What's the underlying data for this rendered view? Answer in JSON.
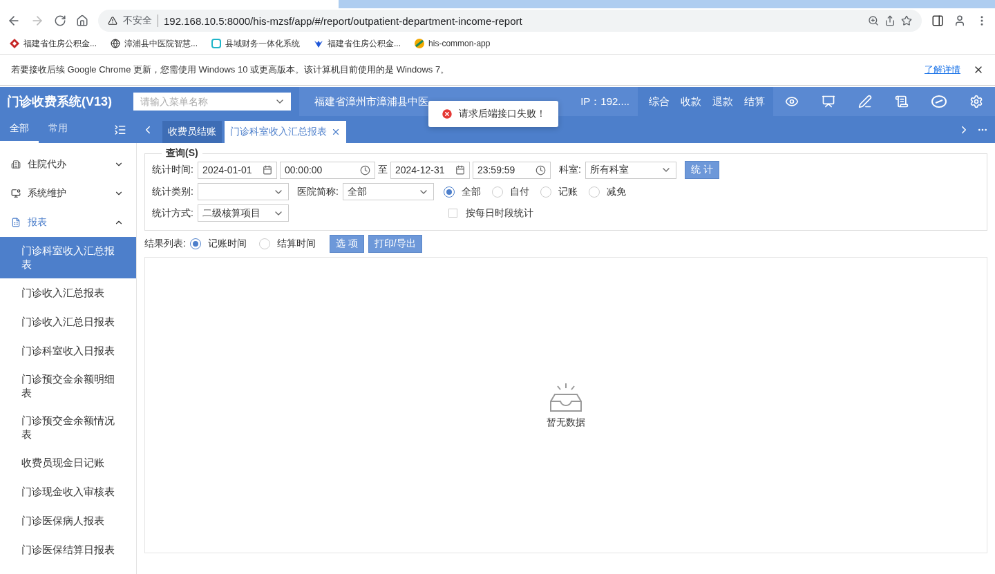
{
  "browser": {
    "url_warning": "不安全",
    "url": "192.168.10.5:8000/his-mzsf/app/#/report/outpatient-department-income-report",
    "bookmarks": [
      {
        "label": "福建省住房公积金...",
        "kind": "diamond"
      },
      {
        "label": "漳浦县中医院智慧...",
        "kind": "globe"
      },
      {
        "label": "县域财务一体化系统",
        "kind": "square"
      },
      {
        "label": "福建省住房公积金...",
        "kind": "bird"
      },
      {
        "label": "his-common-app",
        "kind": "ball"
      }
    ]
  },
  "infobar": {
    "message": "若要接收后续 Google Chrome 更新，您需使用 Windows 10 或更高版本。该计算机目前使用的是 Windows 7。",
    "link": "了解详情"
  },
  "header": {
    "title": "门诊收费系统(V13)",
    "search": {
      "placeholder": "请输入菜单名称"
    },
    "hospital": "福建省漳州市漳浦县中医",
    "ip": "IP：192....",
    "menu": [
      "综合",
      "收款",
      "退款",
      "结算"
    ]
  },
  "toast": {
    "message": "请求后端接口失败！"
  },
  "sidebar": {
    "tabs": [
      {
        "label": "全部",
        "selected": true
      },
      {
        "label": "常用",
        "selected": false
      }
    ],
    "groups": [
      {
        "label": "住院代办",
        "expanded": false,
        "kind": "building"
      },
      {
        "label": "系统维护",
        "expanded": false,
        "kind": "monitor"
      },
      {
        "label": "报表",
        "expanded": true,
        "kind": "report"
      }
    ],
    "items": [
      {
        "label": "门诊科室收入汇总报表",
        "selected": true
      },
      {
        "label": "门诊收入汇总报表",
        "selected": false
      },
      {
        "label": "门诊收入汇总日报表",
        "selected": false
      },
      {
        "label": "门诊科室收入日报表",
        "selected": false
      },
      {
        "label": "门诊预交金余额明细表",
        "selected": false
      },
      {
        "label": "门诊预交金余额情况表",
        "selected": false
      },
      {
        "label": "收费员现金日记账",
        "selected": false
      },
      {
        "label": "门诊现金收入审核表",
        "selected": false
      },
      {
        "label": "门诊医保病人报表",
        "selected": false
      },
      {
        "label": "门诊医保结算日报表",
        "selected": false
      }
    ]
  },
  "tabs": [
    {
      "label": "收费员结账",
      "selected": false,
      "closable": false
    },
    {
      "label": "门诊科室收入汇总报表",
      "selected": true,
      "closable": true
    }
  ],
  "query": {
    "legend": "查询(S)",
    "time_label": "统计时间:",
    "start_date": "2024-01-01",
    "start_time": "00:00:00",
    "to": "至",
    "end_date": "2024-12-31",
    "end_time": "23:59:59",
    "dept_label": "科室:",
    "dept": "所有科室",
    "stat_button": "统 计",
    "type_label": "统计类别:",
    "hospital_label": "医院简称:",
    "hospital": "全部",
    "pay_options": [
      {
        "label": "全部",
        "selected": true
      },
      {
        "label": "自付",
        "selected": false
      },
      {
        "label": "记账",
        "selected": false
      },
      {
        "label": "减免",
        "selected": false
      }
    ],
    "method_label": "统计方式:",
    "method": "二级核算项目",
    "by_period": {
      "label": "按每日时段统计",
      "checked": false
    }
  },
  "results": {
    "label": "结果列表:",
    "options": [
      {
        "label": "记账时间",
        "selected": true
      },
      {
        "label": "结算时间",
        "selected": false
      }
    ],
    "buttons": [
      "选 项",
      "打印/导出"
    ],
    "empty": "暂无数据"
  }
}
